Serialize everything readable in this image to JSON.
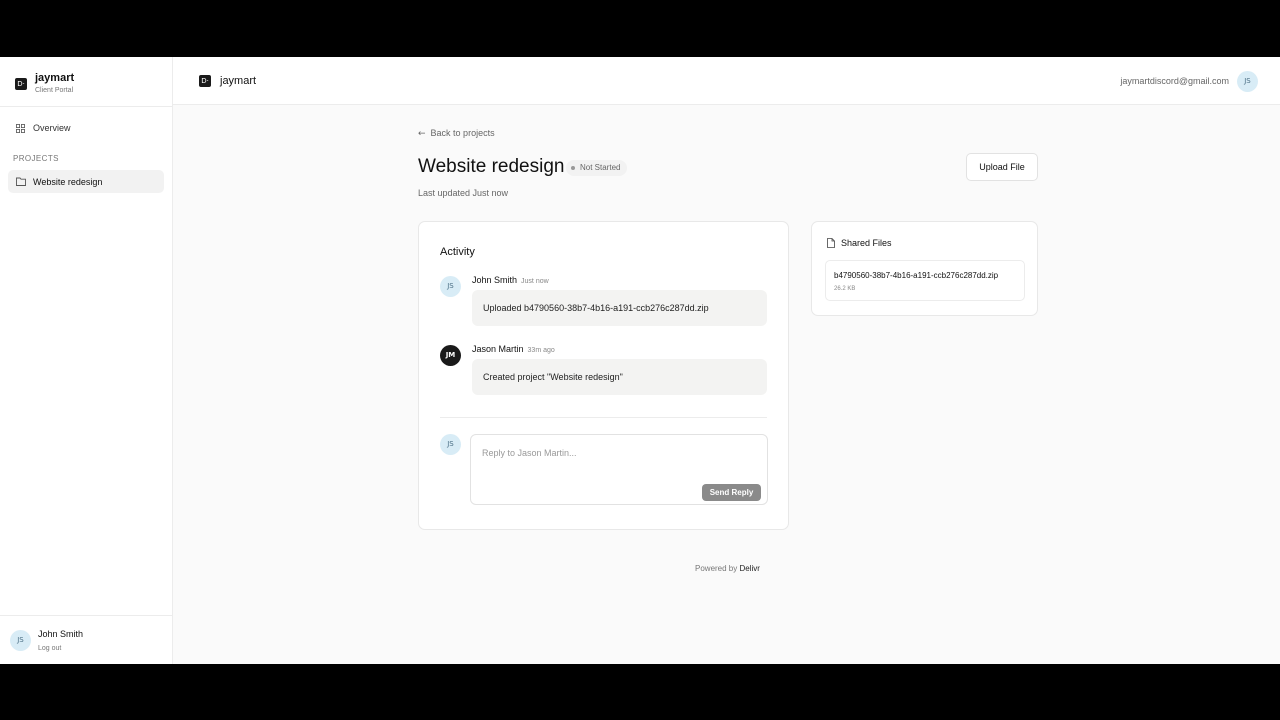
{
  "sidebar": {
    "brand_name": "jaymart",
    "brand_sub": "Client Portal",
    "logo_glyph": "D·",
    "nav_overview": "Overview",
    "section_label": "PROJECTS",
    "project_item": "Website redesign",
    "user_initials": "JS",
    "user_name": "John Smith",
    "logout": "Log out"
  },
  "header": {
    "logo_glyph": "D·",
    "brand": "jaymart",
    "email": "jaymartdiscord@gmail.com",
    "avatar_initials": "JS"
  },
  "main": {
    "back_link": "Back to projects",
    "title": "Website redesign",
    "status": "Not Started",
    "last_updated": "Last updated Just now",
    "upload_button": "Upload File"
  },
  "activity": {
    "title": "Activity",
    "items": [
      {
        "initials": "JS",
        "name": "John Smith",
        "time": "Just now",
        "text": "Uploaded b4790560-38b7-4b16-a191-ccb276c287dd.zip"
      },
      {
        "initials": "JM",
        "name": "Jason Martin",
        "time": "33m ago",
        "text": "Created project \"Website redesign\""
      }
    ],
    "reply_initials": "JS",
    "reply_placeholder": "Reply to Jason Martin...",
    "send_button": "Send Reply"
  },
  "files": {
    "title": "Shared Files",
    "items": [
      {
        "name": "b4790560-38b7-4b16-a191-ccb276c287dd.zip",
        "size": "26.2 KB"
      }
    ]
  },
  "footer": {
    "powered_prefix": "Powered by",
    "powered_brand": "Delivr"
  },
  "colors": {
    "accent_dark": "#1a1a1a",
    "avatar_light_bg": "#d8ecf6",
    "send_button_bg": "#8a8a8a"
  }
}
